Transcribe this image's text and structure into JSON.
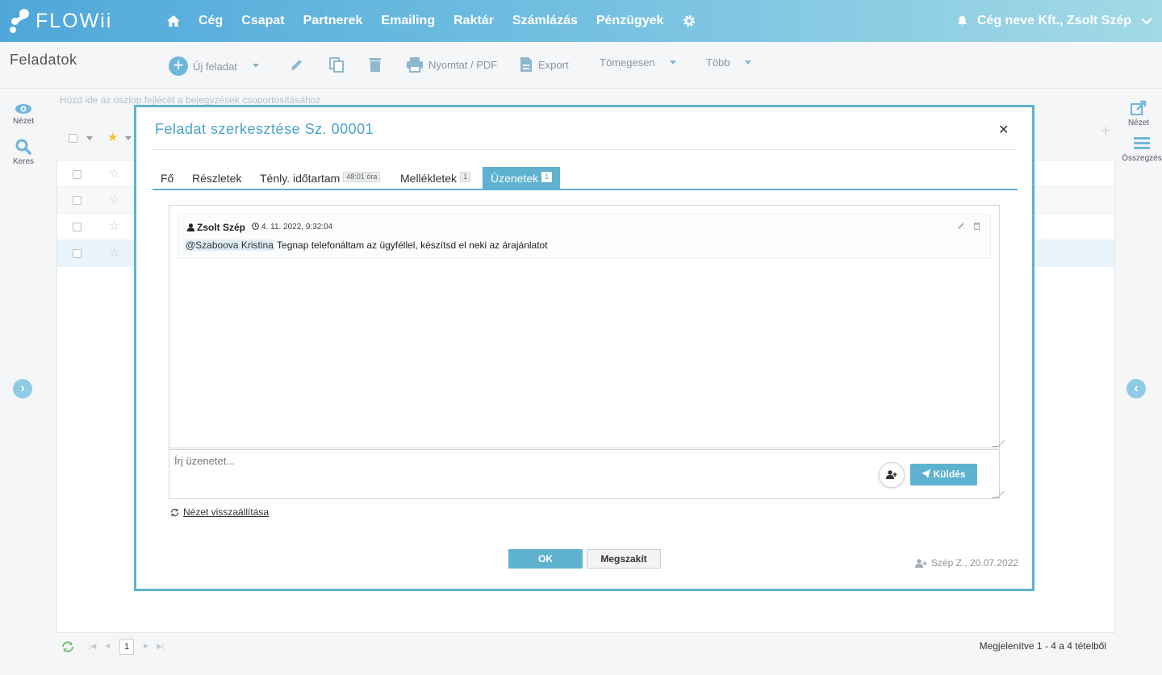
{
  "app": {
    "logo": "FLOWii"
  },
  "nav": {
    "items": [
      "Cég",
      "Csapat",
      "Partnerek",
      "Emailing",
      "Raktár",
      "Számlázás",
      "Pénzügyek"
    ],
    "user": "Cég neve Kft., Zsolt Szép"
  },
  "page": {
    "title": "Feladatok"
  },
  "toolbar": {
    "new_task": "Új feladat",
    "print": "Nyomtat / PDF",
    "export": "Export",
    "bulk": "Tömegesen",
    "more": "Több"
  },
  "left_side": {
    "view": "Nézet",
    "search": "Keres"
  },
  "right_side": {
    "view": "Nézet",
    "summary": "Összegzés"
  },
  "grid": {
    "group_hint": "Húzd ide az oszlop fejlécét a bejegyzések csoportosításához",
    "page": "1",
    "status": "Megjelenítve 1 - 4 a 4 tételből"
  },
  "modal": {
    "title": "Feladat szerkesztése Sz. 00001",
    "tabs": [
      {
        "label": "Fő",
        "badge": ""
      },
      {
        "label": "Részletek",
        "badge": ""
      },
      {
        "label": "Ténly. időtartam",
        "badge": "48:01 óra"
      },
      {
        "label": "Mellékletek",
        "badge": "1"
      },
      {
        "label": "Üzenetek",
        "badge": "1"
      }
    ],
    "message": {
      "author": "Zsolt Szép",
      "time": "4. 11. 2022, 9:32:04",
      "mention": "@Szaboova Kristina",
      "text": " Tegnap telefonáltam az ügyféllel, készítsd el neki az árajánlatot"
    },
    "compose_placeholder": "Írj üzenetet...",
    "send": "Küldés",
    "reset_view": "Nézet visszaállítása",
    "ok": "OK",
    "cancel": "Megszakít",
    "created": "Szép Z., 20.07.2022"
  },
  "colors": {
    "accent": "#5eb2cf",
    "nav_gradient_start": "#4fa7d9",
    "nav_gradient_end": "#a3d9e6"
  }
}
